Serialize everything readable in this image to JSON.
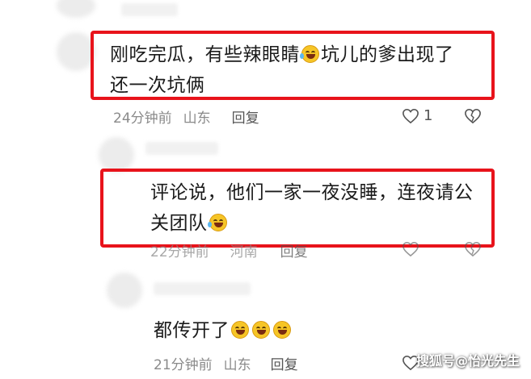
{
  "comments": [
    {
      "text_line1_before": "刚吃完瓜，有些辣眼睛",
      "text_line1_after": "坑儿的爹出现了",
      "text_line2": "还一次坑俩",
      "time": "24分钟前",
      "location": "山东",
      "reply_label": "回复",
      "likes": "1",
      "emoji": "laughing-tears-emoji"
    },
    {
      "text_line1": "评论说，他们一家一夜没睡，连夜请公",
      "text_line2": "关团队",
      "time": "22分钟前",
      "location": "河南",
      "reply_label": "回复",
      "emoji": "laughing-tears-emoji"
    },
    {
      "text": "都传开了",
      "time": "21分钟前",
      "location": "山东",
      "reply_label": "回复",
      "emoji": "grinning-emoji"
    }
  ],
  "watermark": "搜狐号@怡光先生",
  "highlight_color": "#e8131b"
}
